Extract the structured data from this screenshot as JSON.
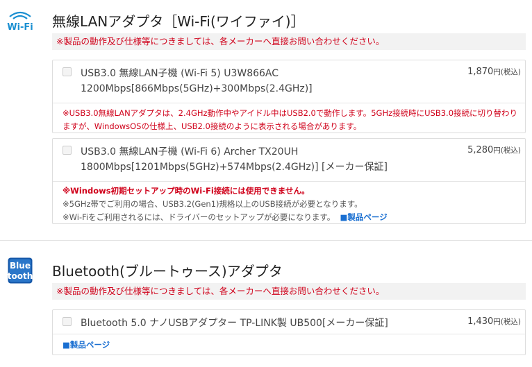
{
  "wifi_section": {
    "icon": "wifi-icon",
    "icon_text": "Wi-Fi",
    "title": "無線LANアダプタ［Wi-Fi(ワイファイ)］",
    "notice": "※製品の動作及び仕様等につきましては、各メーカーへ直接お問い合わせください。",
    "products": [
      {
        "name": "USB3.0 無線LAN子機 (Wi-Fi 5) U3W866AC",
        "spec": "1200Mbps[866Mbps(5GHz)+300Mbps(2.4GHz)]",
        "price": "1,870",
        "price_unit": "円(税込)",
        "notes": [
          {
            "style": "red",
            "text": "※USB3.0無線LANアダプタは、2.4GHz動作中やアイドル中はUSB2.0で動作します。5GHz接続時にUSB3.0接続に切り替わりますが、WindowsOSの仕様上、USB2.0接続のように表示される場合があります。"
          }
        ]
      },
      {
        "name": "USB3.0 無線LAN子機 (Wi-Fi 6) Archer TX20UH",
        "spec": "1800Mbps[1201Mbps(5GHz)+574Mbps(2.4GHz)] [メーカー保証]",
        "price": "5,280",
        "price_unit": "円(税込)",
        "notes": [
          {
            "style": "bold-red",
            "text": "※Windows初期セットアップ時のWi-Fi接続には使用できません。"
          },
          {
            "style": "gray",
            "text": "※5GHz帯でご利用の場合、USB3.2(Gen1)規格以上のUSB接続が必要となります。"
          },
          {
            "style": "gray",
            "text": "※Wi-Fiをご利用されるには、ドライバーのセットアップが必要になります。"
          }
        ],
        "link": "■製品ページ"
      }
    ]
  },
  "bt_section": {
    "icon": "bluetooth-icon",
    "icon_text_1": "Blue",
    "icon_text_2": "tooth",
    "title": "Bluetooth(ブルートゥース)アダプタ",
    "notice": "※製品の動作及び仕様等につきましては、各メーカーへ直接お問い合わせください。",
    "products": [
      {
        "name": "Bluetooth 5.0 ナノUSBアダプター TP-LINK製 UB500[メーカー保証]",
        "price": "1,430",
        "price_unit": "円(税込)",
        "link": "■製品ページ"
      }
    ]
  }
}
